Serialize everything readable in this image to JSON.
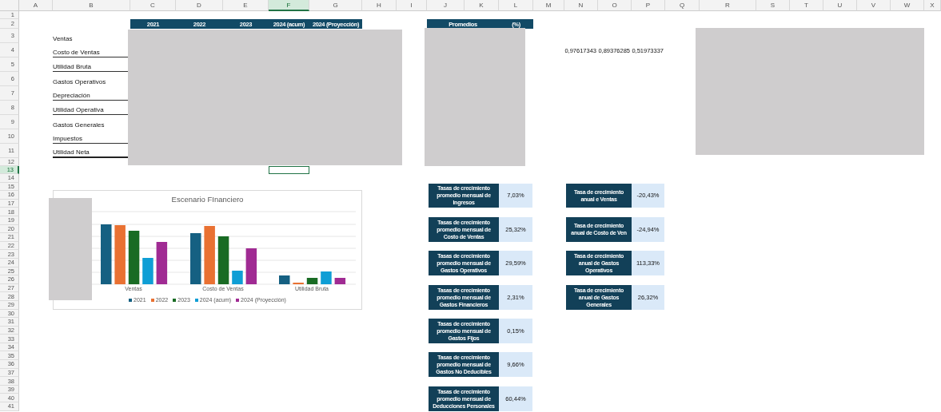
{
  "columns": [
    {
      "label": "A",
      "selected": false
    },
    {
      "label": "B",
      "selected": false
    },
    {
      "label": "C",
      "selected": false
    },
    {
      "label": "D",
      "selected": false
    },
    {
      "label": "E",
      "selected": false
    },
    {
      "label": "F",
      "selected": true
    },
    {
      "label": "G",
      "selected": false
    },
    {
      "label": "H",
      "selected": false
    },
    {
      "label": "I",
      "selected": false
    },
    {
      "label": "J",
      "selected": false
    },
    {
      "label": "K",
      "selected": false
    },
    {
      "label": "L",
      "selected": false
    },
    {
      "label": "M",
      "selected": false
    },
    {
      "label": "N",
      "selected": false
    },
    {
      "label": "O",
      "selected": false
    },
    {
      "label": "P",
      "selected": false
    },
    {
      "label": "Q",
      "selected": false
    },
    {
      "label": "R",
      "selected": false
    },
    {
      "label": "S",
      "selected": false
    },
    {
      "label": "T",
      "selected": false
    },
    {
      "label": "U",
      "selected": false
    },
    {
      "label": "V",
      "selected": false
    },
    {
      "label": "W",
      "selected": false
    },
    {
      "label": "X",
      "selected": false
    }
  ],
  "rows": [
    {
      "label": "1",
      "selected": false
    },
    {
      "label": "2",
      "selected": false
    },
    {
      "label": "3",
      "selected": false
    },
    {
      "label": "4",
      "selected": false
    },
    {
      "label": "5",
      "selected": false
    },
    {
      "label": "6",
      "selected": false
    },
    {
      "label": "7",
      "selected": false
    },
    {
      "label": "8",
      "selected": false
    },
    {
      "label": "9",
      "selected": false
    },
    {
      "label": "10",
      "selected": false
    },
    {
      "label": "11",
      "selected": false
    },
    {
      "label": "12",
      "selected": false
    },
    {
      "label": "13",
      "selected": true
    },
    {
      "label": "14",
      "selected": false
    },
    {
      "label": "15",
      "selected": false
    },
    {
      "label": "16",
      "selected": false
    },
    {
      "label": "17",
      "selected": false
    },
    {
      "label": "18",
      "selected": false
    },
    {
      "label": "19",
      "selected": false
    },
    {
      "label": "20",
      "selected": false
    },
    {
      "label": "21",
      "selected": false
    },
    {
      "label": "22",
      "selected": false
    },
    {
      "label": "23",
      "selected": false
    },
    {
      "label": "24",
      "selected": false
    },
    {
      "label": "25",
      "selected": false
    },
    {
      "label": "26",
      "selected": false
    },
    {
      "label": "27",
      "selected": false
    },
    {
      "label": "28",
      "selected": false
    },
    {
      "label": "29",
      "selected": false
    },
    {
      "label": "30",
      "selected": false
    },
    {
      "label": "31",
      "selected": false
    },
    {
      "label": "32",
      "selected": false
    },
    {
      "label": "33",
      "selected": false
    },
    {
      "label": "34",
      "selected": false
    },
    {
      "label": "35",
      "selected": false
    },
    {
      "label": "36",
      "selected": false
    },
    {
      "label": "37",
      "selected": false
    },
    {
      "label": "38",
      "selected": false
    },
    {
      "label": "39",
      "selected": false
    },
    {
      "label": "40",
      "selected": false
    },
    {
      "label": "41",
      "selected": false
    }
  ],
  "year_headers": [
    "2021",
    "2022",
    "2023",
    "2024 (acum)",
    "2024 (Proyección)"
  ],
  "line_items": [
    {
      "label": "Ventas",
      "underlined": false,
      "total": false
    },
    {
      "label": "Costo de Ventas",
      "underlined": true,
      "total": false
    },
    {
      "label": "Utilidad Bruta",
      "underlined": true,
      "total": false
    },
    {
      "label": "Gastos Operativos",
      "underlined": false,
      "total": false
    },
    {
      "label": "Depreciación",
      "underlined": true,
      "total": false
    },
    {
      "label": "Utilidad Operativa",
      "underlined": true,
      "total": false
    },
    {
      "label": "Gastos Generales",
      "underlined": false,
      "total": false
    },
    {
      "label": "Impuestos",
      "underlined": true,
      "total": false
    },
    {
      "label": "Utilidad Neta",
      "underlined": true,
      "total": true
    }
  ],
  "averages_header": {
    "label": "Promedios",
    "unit": "(%)"
  },
  "row_4_values": [
    "0,97617343",
    "0,89376285",
    "0,51973337"
  ],
  "chart": {
    "title": "Escenario FInanciero",
    "categories": [
      "Ventas",
      "Costo de Ventas",
      "Utilidad Bruta"
    ],
    "series": [
      {
        "name": "2021",
        "color": "#156082"
      },
      {
        "name": "2022",
        "color": "#e97132"
      },
      {
        "name": "2023",
        "color": "#196b24"
      },
      {
        "name": "2024 (acum)",
        "color": "#0f9ed5"
      },
      {
        "name": "2024 (Proyección)",
        "color": "#a02b93"
      }
    ]
  },
  "monthly_rates": [
    {
      "label": "Tasas de crecimiento promedio mensual de Ingresos",
      "value": "7,03%"
    },
    {
      "label": "Tasas de crecimiento promedio mensual de Costo de Ventas",
      "value": "25,32%"
    },
    {
      "label": "Tasas de crecimiento promedio mensual de Gastos Operativos",
      "value": "29,59%"
    },
    {
      "label": "Tasas de crecimiento promedio mensual de Gastos Financieros",
      "value": "2,31%"
    },
    {
      "label": "Tasas de crecimiento promedio mensual de Gastos Fijos",
      "value": "0,15%"
    },
    {
      "label": "Tasas de crecimiento promedio mensual de Gastos No Deducibles",
      "value": "9,66%"
    },
    {
      "label": "Tasas de crecimiento promedio mensual de Deducciones Personales",
      "value": "60,44%"
    }
  ],
  "annual_rates": [
    {
      "label": "Tasa de crecimiento anual e Ventas",
      "value": "-20,43%"
    },
    {
      "label": "Tasa de crecimiento anual de Costo de Ven",
      "value": "-24,94%"
    },
    {
      "label": "Tasa de crecimiento anual de Gastos Operativos",
      "value": "113,33%"
    },
    {
      "label": "Tasa de crecimiento anual de Gastos Generales",
      "value": "26,32%"
    }
  ]
}
